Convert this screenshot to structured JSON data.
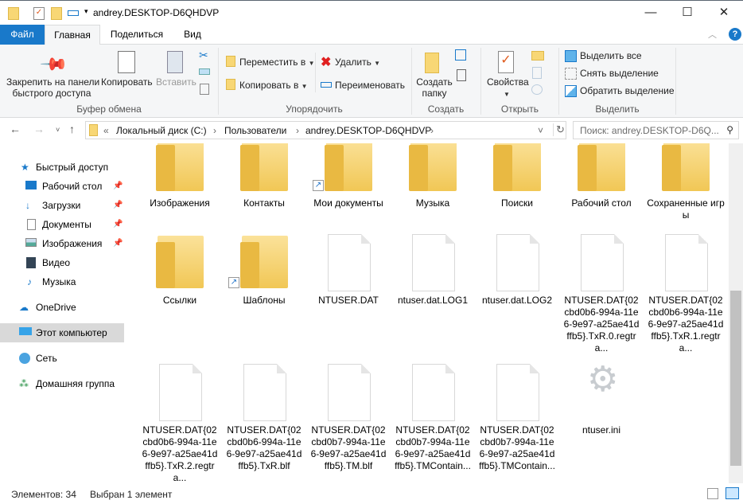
{
  "window": {
    "title": "andrey.DESKTOP-D6QHDVP",
    "minimize": "—",
    "maximize": "☐",
    "close": "✕"
  },
  "tabs": [
    "Файл",
    "Главная",
    "Поделиться",
    "Вид"
  ],
  "ribbon": {
    "clipboard": {
      "pin": "Закрепить на панели",
      "pin2": "быстрого доступа",
      "copy": "Копировать",
      "paste": "Вставить",
      "label": "Буфер обмена"
    },
    "organize": {
      "move": "Переместить в",
      "copyto": "Копировать в",
      "delete": "Удалить",
      "rename": "Переименовать",
      "label": "Упорядочить"
    },
    "create": {
      "newfolder": "Создать",
      "newfolder2": "папку",
      "label": "Создать"
    },
    "open": {
      "properties": "Свойства",
      "label": "Открыть"
    },
    "select": {
      "all": "Выделить все",
      "none": "Снять выделение",
      "invert": "Обратить выделение",
      "label": "Выделить"
    }
  },
  "address": {
    "prefix": "«",
    "crumbs": [
      "Локальный диск (C:)",
      "Пользователи",
      "andrey.DESKTOP-D6QHDVP"
    ],
    "search_placeholder": "Поиск: andrey.DESKTOP-D6Q..."
  },
  "nav": {
    "quick": "Быстрый доступ",
    "items": [
      "Рабочий стол",
      "Загрузки",
      "Документы",
      "Изображения",
      "Видео",
      "Музыка"
    ],
    "onedrive": "OneDrive",
    "thispc": "Этот компьютер",
    "network": "Сеть",
    "homegroup": "Домашняя группа"
  },
  "files": [
    {
      "name": "Изображения",
      "type": "folder"
    },
    {
      "name": "Контакты",
      "type": "folder"
    },
    {
      "name": "Мои документы",
      "type": "shortcut-folder"
    },
    {
      "name": "Музыка",
      "type": "folder"
    },
    {
      "name": "Поиски",
      "type": "folder"
    },
    {
      "name": "Рабочий стол",
      "type": "folder"
    },
    {
      "name": "Сохраненные игры",
      "type": "folder"
    },
    {
      "name": "Ссылки",
      "type": "folder"
    },
    {
      "name": "Шаблоны",
      "type": "shortcut-folder"
    },
    {
      "name": "NTUSER.DAT",
      "type": "file"
    },
    {
      "name": "ntuser.dat.LOG1",
      "type": "file"
    },
    {
      "name": "ntuser.dat.LOG2",
      "type": "file"
    },
    {
      "name": "NTUSER.DAT{02cbd0b6-994a-11e6-9e97-a25ae41dffb5}.TxR.0.regtra...",
      "type": "file"
    },
    {
      "name": "NTUSER.DAT{02cbd0b6-994a-11e6-9e97-a25ae41dffb5}.TxR.1.regtra...",
      "type": "file"
    },
    {
      "name": "NTUSER.DAT{02cbd0b6-994a-11e6-9e97-a25ae41dffb5}.TxR.2.regtra...",
      "type": "file"
    },
    {
      "name": "NTUSER.DAT{02cbd0b6-994a-11e6-9e97-a25ae41dffb5}.TxR.blf",
      "type": "file"
    },
    {
      "name": "NTUSER.DAT{02cbd0b7-994a-11e6-9e97-a25ae41dffb5}.TM.blf",
      "type": "file"
    },
    {
      "name": "NTUSER.DAT{02cbd0b7-994a-11e6-9e97-a25ae41dffb5}.TMContain...",
      "type": "file"
    },
    {
      "name": "NTUSER.DAT{02cbd0b7-994a-11e6-9e97-a25ae41dffb5}.TMContain...",
      "type": "file"
    },
    {
      "name": "ntuser.ini",
      "type": "settings"
    }
  ],
  "status": {
    "count": "Элементов: 34",
    "selected": "Выбран 1 элемент"
  }
}
